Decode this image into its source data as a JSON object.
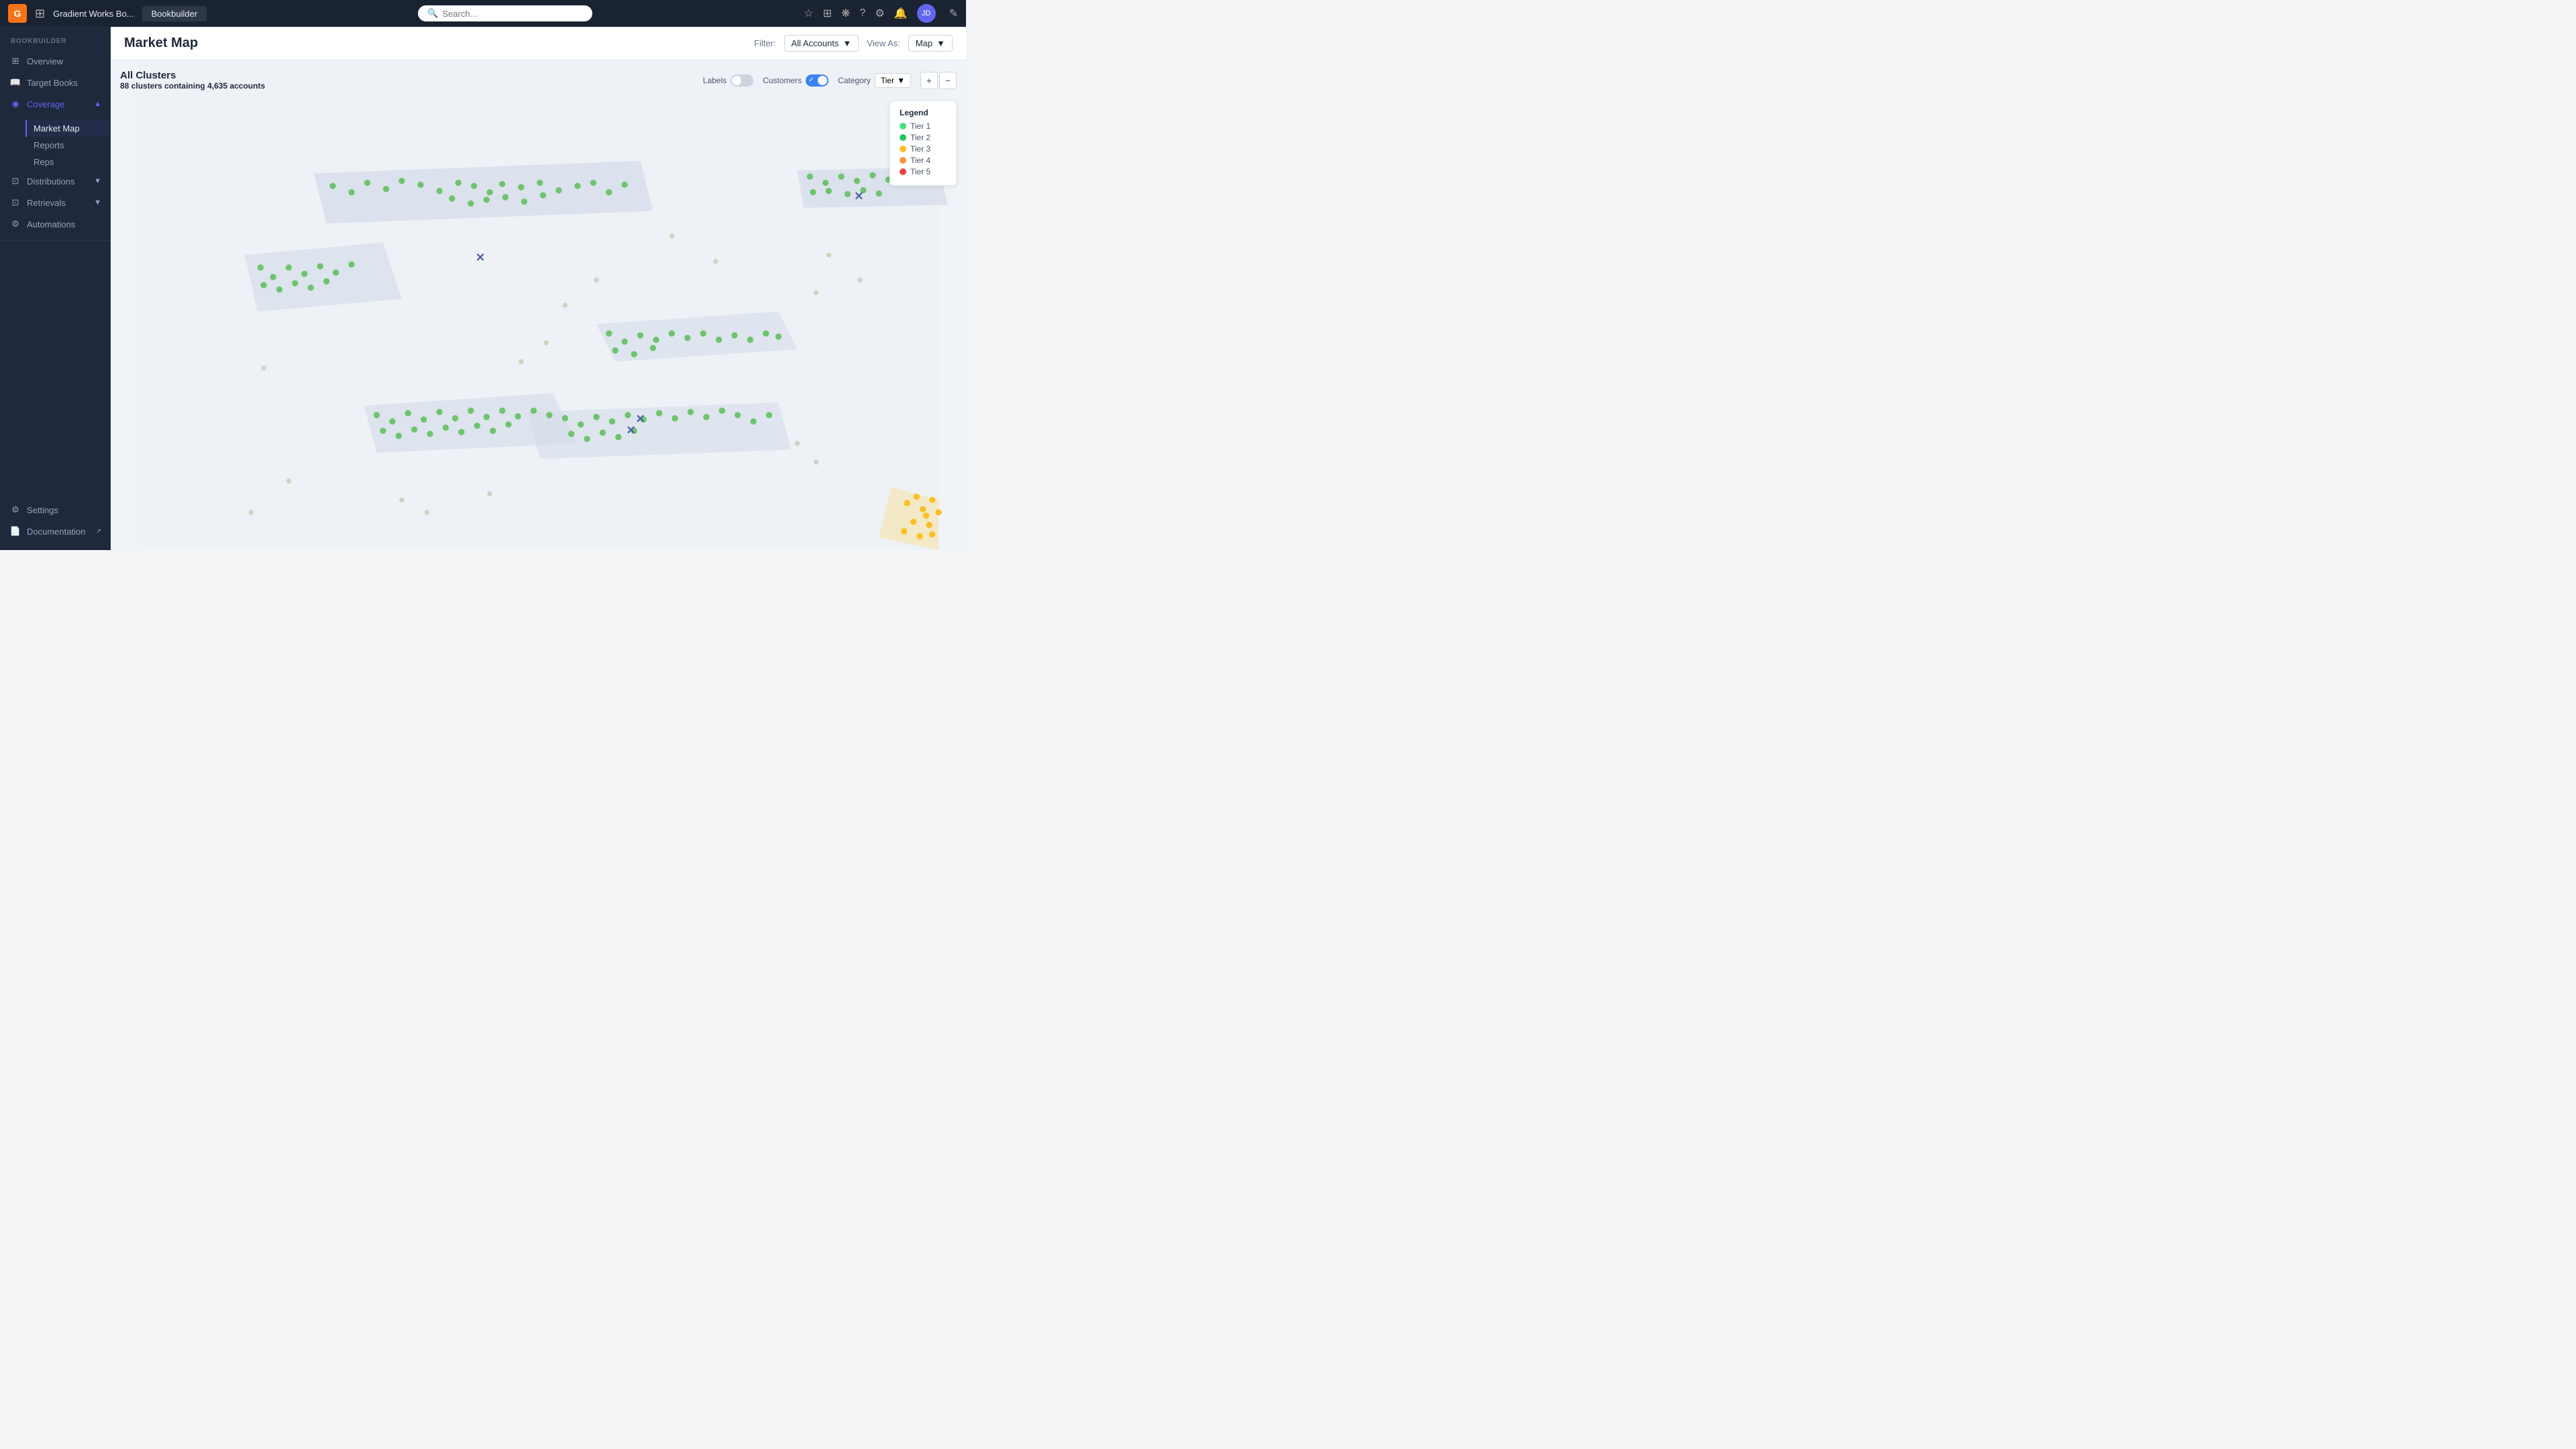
{
  "topnav": {
    "logo_text": "G",
    "app_name": "Gradient Works Bo...",
    "tab_label": "Bookbuilder",
    "search_placeholder": "Search...",
    "edit_icon": "✎"
  },
  "sidebar": {
    "section_title": "BOOKBUILDER",
    "items": [
      {
        "id": "overview",
        "label": "Overview",
        "icon": "⊞"
      },
      {
        "id": "target-books",
        "label": "Target Books",
        "icon": "📖"
      },
      {
        "id": "coverage",
        "label": "Coverage",
        "icon": "◉",
        "active": true,
        "expanded": true,
        "children": [
          {
            "id": "market-map",
            "label": "Market Map",
            "active": true
          },
          {
            "id": "reports",
            "label": "Reports"
          },
          {
            "id": "reps",
            "label": "Reps"
          }
        ]
      },
      {
        "id": "distributions",
        "label": "Distributions",
        "icon": "⊡"
      },
      {
        "id": "retrievals",
        "label": "Retrievals",
        "icon": "⊡"
      },
      {
        "id": "automations",
        "label": "Automations",
        "icon": "⚙"
      }
    ],
    "bottom_items": [
      {
        "id": "settings",
        "label": "Settings",
        "icon": "⚙"
      },
      {
        "id": "documentation",
        "label": "Documentation",
        "icon": "📄",
        "external": true
      }
    ]
  },
  "page": {
    "title": "Market Map",
    "filter_label": "Filter:",
    "filter_value": "All Accounts",
    "view_as_label": "View As:",
    "view_as_value": "Map"
  },
  "map": {
    "clusters_title": "All Clusters",
    "clusters_count": "88 clusters",
    "clusters_containing": "containing",
    "accounts_count": "4,635 accounts",
    "labels_toggle": false,
    "customers_toggle": true,
    "category_label": "Tier",
    "legend_title": "Legend",
    "legend_items": [
      {
        "label": "Tier 1",
        "color": "#4ade80"
      },
      {
        "label": "Tier 2",
        "color": "#22c55e"
      },
      {
        "label": "Tier 3",
        "color": "#fbbf24"
      },
      {
        "label": "Tier 4",
        "color": "#fb923c"
      },
      {
        "label": "Tier 5",
        "color": "#ef4444"
      }
    ]
  }
}
